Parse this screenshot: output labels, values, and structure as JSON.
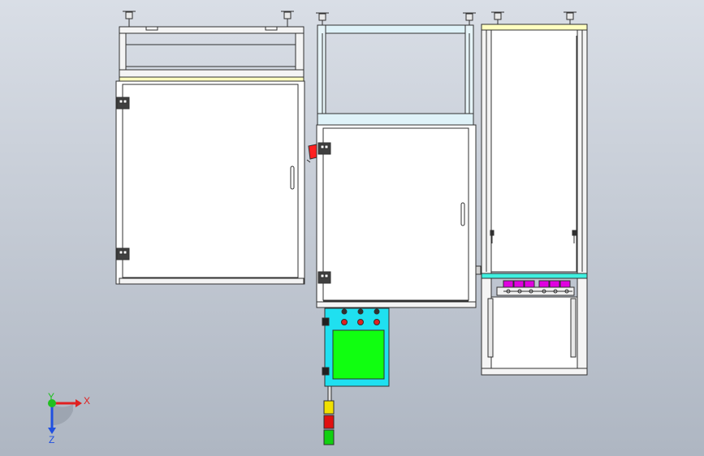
{
  "viewport": {
    "background_top": "#d9dee6",
    "background_bottom": "#aeb6c2"
  },
  "triad": {
    "x_label": "X",
    "y_label": "Y",
    "z_label": "Z",
    "x_color": "#e02020",
    "y_color": "#20c020",
    "z_color": "#2050e0"
  },
  "colors": {
    "frame_line": "#303030",
    "panel_fill": "#ffffff",
    "beam_cyan": "#dff2f8",
    "accent_yellow": "#ffffc0",
    "control_box": "#1fe0f0",
    "hmi_screen": "#10ff10",
    "button_red": "#e02020",
    "tower_red": "#e01010",
    "tower_yellow": "#f0e000",
    "tower_green": "#10d010",
    "cyan_tray": "#40f0e0",
    "magenta_parts": "#e000e0",
    "indicator_red": "#ff2020"
  }
}
